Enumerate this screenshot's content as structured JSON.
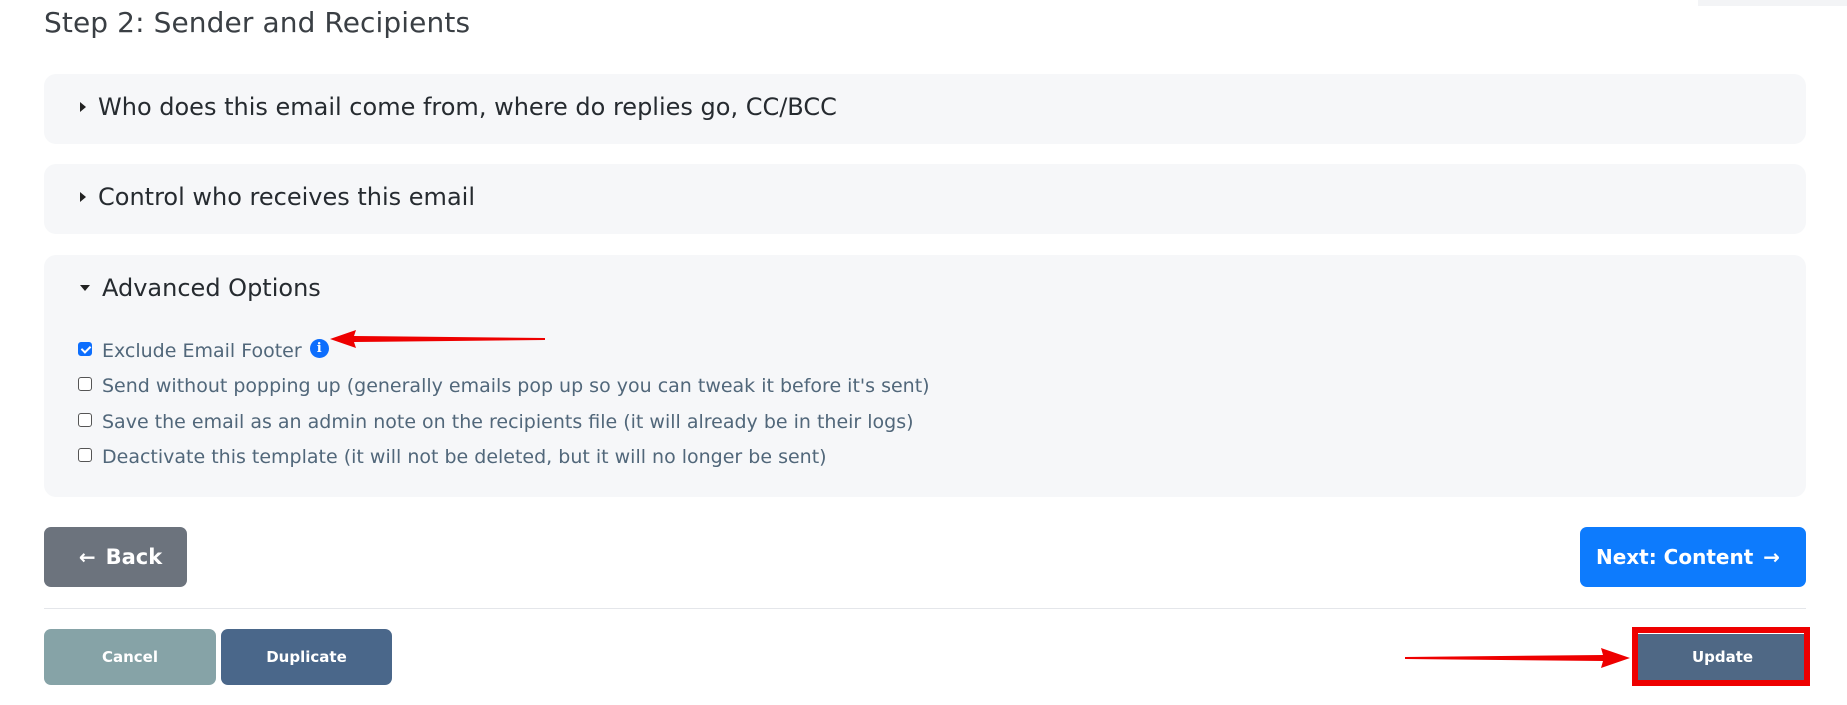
{
  "step_title": "Step 2: Sender and Recipients",
  "panels": [
    {
      "label": "Who does this email come from, where do replies go, CC/BCC",
      "expanded": false
    },
    {
      "label": "Control who receives this email",
      "expanded": false
    },
    {
      "label": "Advanced Options",
      "expanded": true
    }
  ],
  "advanced_options": [
    {
      "label": "Exclude Email Footer",
      "checked": true
    },
    {
      "label": "Send without popping up (generally emails pop up so you can tweak it before it's sent)",
      "checked": false
    },
    {
      "label": "Save the email as an admin note on the recipients file (it will already be in their logs)",
      "checked": false
    },
    {
      "label": "Deactivate this template (it will not be deleted, but it will no longer be sent)",
      "checked": false
    }
  ],
  "buttons": {
    "back": "Back",
    "next": "Next: Content",
    "cancel": "Cancel",
    "duplicate": "Duplicate",
    "update": "Update"
  },
  "icons": {
    "info": "i",
    "arrow_left": "←",
    "arrow_right": "→"
  },
  "colors": {
    "primary": "#0d7bfd",
    "annotation_red": "#ee0000"
  }
}
